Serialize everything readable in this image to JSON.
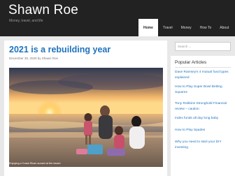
{
  "site": {
    "title": "Shawn Roe",
    "tagline": "Money, travel, and life"
  },
  "nav": {
    "items": [
      {
        "label": "Home",
        "active": true
      },
      {
        "label": "Travel",
        "active": false
      },
      {
        "label": "Money",
        "active": false
      },
      {
        "label": "How To",
        "active": false
      },
      {
        "label": "About",
        "active": false
      }
    ]
  },
  "post": {
    "title": "2021 is a rebuilding year",
    "meta": "December 30, 2020 by Shawn Roe",
    "caption": "Enjoying a Costa Rican sunset at the beach"
  },
  "sidebar": {
    "search_placeholder": "Search ...",
    "popular_title": "Popular Articles",
    "popular": [
      "Dave Ramsey's 4 mutual fund types explained",
      "How to Play Super Bowl Betting Squares",
      "Tony Robbins Stronghold Financial review – caution",
      "Index funds all day long baby",
      "How to Play Spades",
      "Why you need to start your DIY investing"
    ]
  },
  "colors": {
    "header_bg": "#222222",
    "link": "#1e73be",
    "page_bg": "#e8e8e8"
  }
}
